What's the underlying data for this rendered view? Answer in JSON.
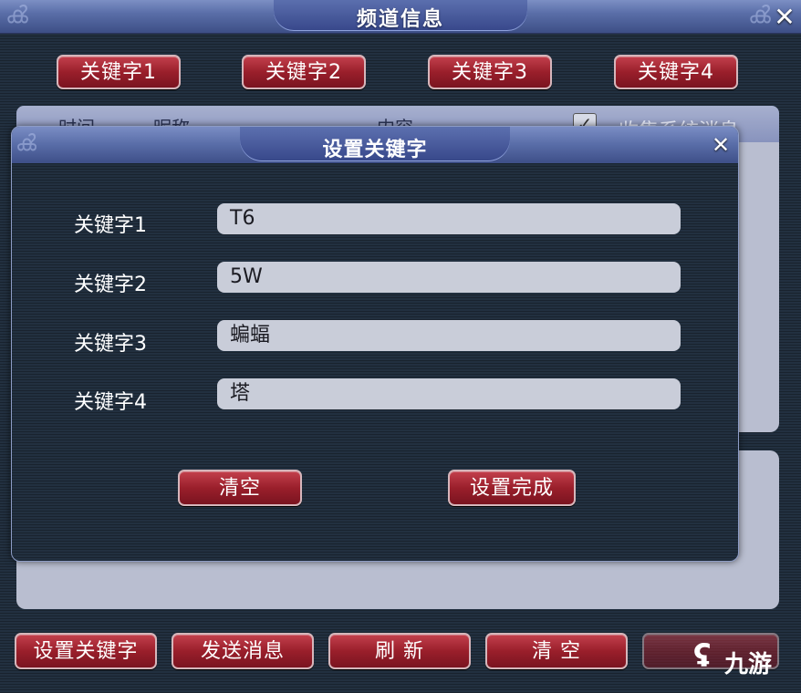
{
  "window": {
    "title": "频道信息"
  },
  "keyword_tabs": [
    "关键字1",
    "关键字2",
    "关键字3",
    "关键字4"
  ],
  "message_table": {
    "headers": [
      "时间",
      "昵称",
      "内容"
    ],
    "collect_system_label": "收集系统消息",
    "collect_system_checked": true
  },
  "dialog": {
    "title": "设置关键字",
    "fields": [
      {
        "label": "关键字1",
        "value": "T6"
      },
      {
        "label": "关键字2",
        "value": "5W"
      },
      {
        "label": "关键字3",
        "value": "蝙蝠"
      },
      {
        "label": "关键字4",
        "value": "塔"
      }
    ],
    "clear_button": "清空",
    "done_button": "设置完成"
  },
  "bottom_buttons": [
    "设置关键字",
    "发送消息",
    "刷 新",
    "清 空"
  ],
  "watermark": {
    "text": "九游"
  },
  "colors": {
    "accent_red": "#9a1f2b",
    "title_blue": "#4d5f9b",
    "panel_light": "#b9bed0"
  },
  "icons": {
    "close": "close-icon",
    "checkbox": "checkbox-checked-icon"
  }
}
